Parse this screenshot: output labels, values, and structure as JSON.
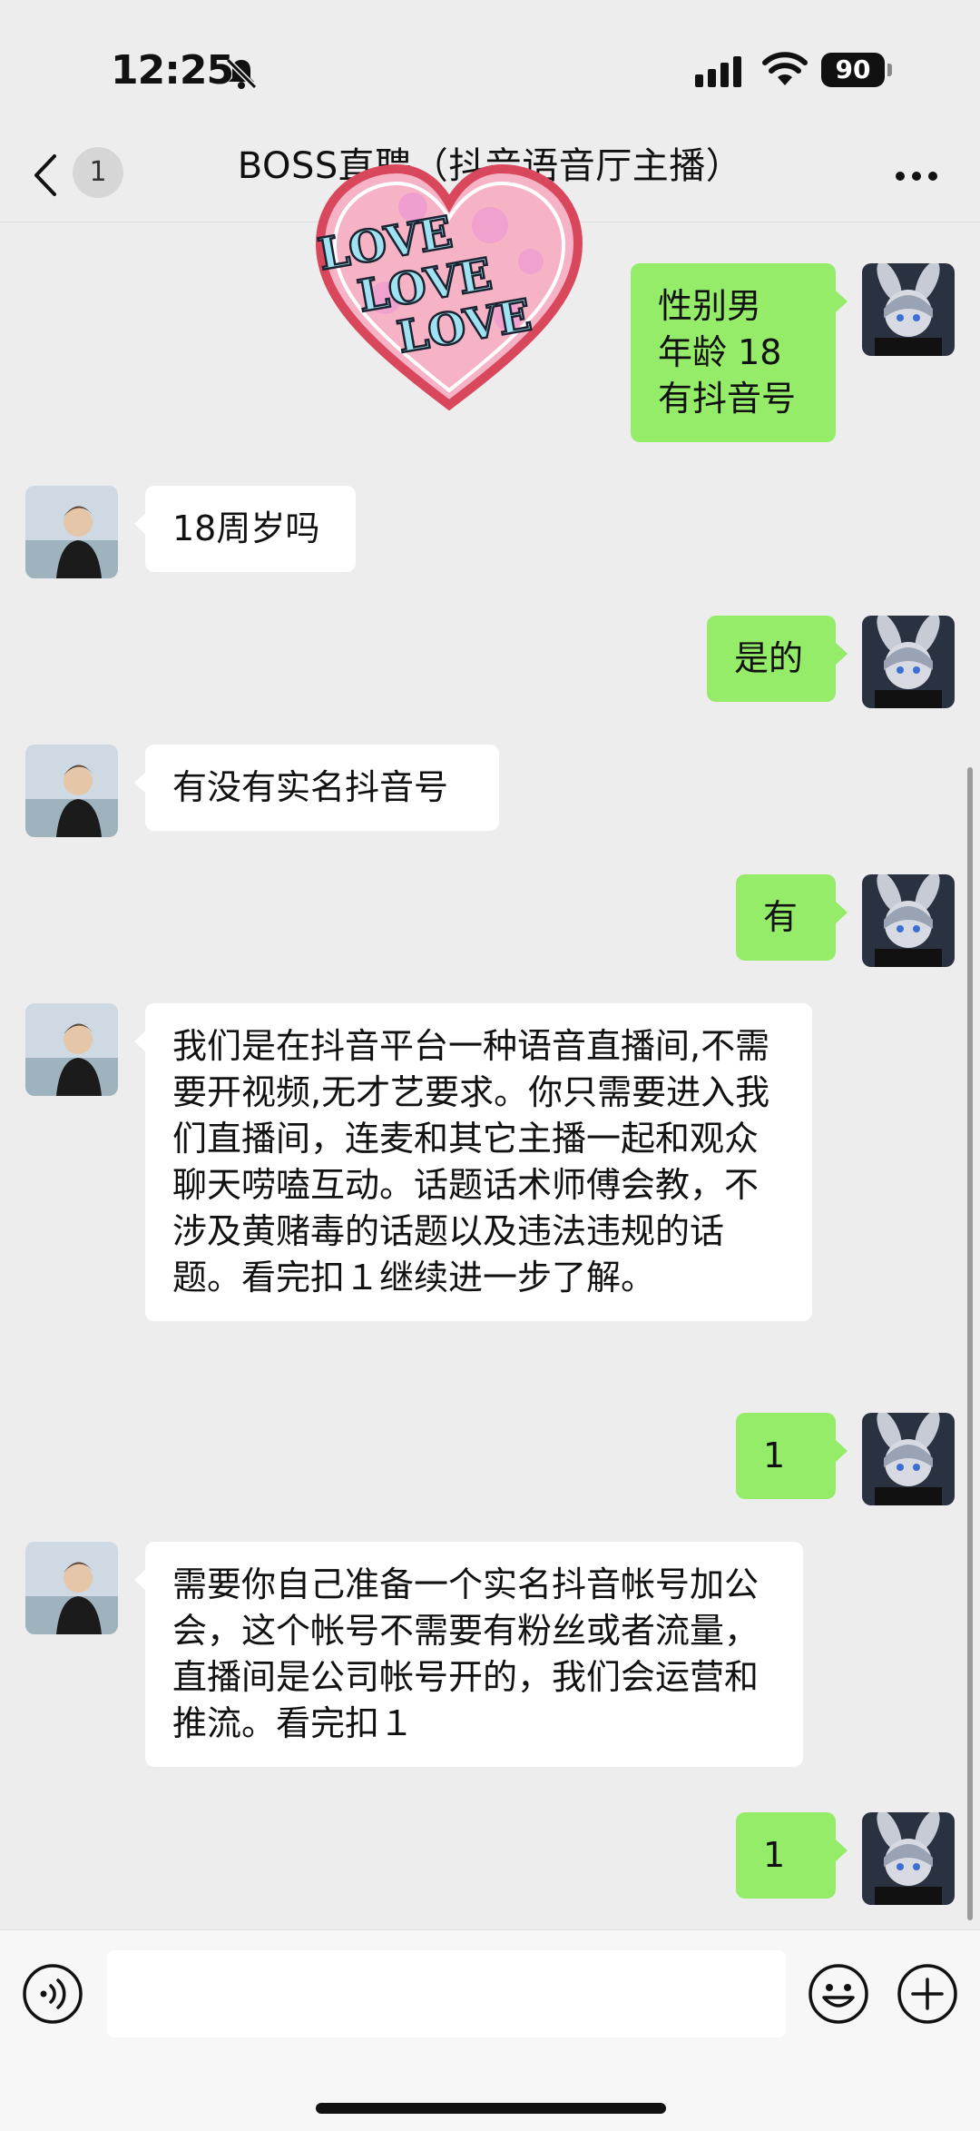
{
  "status_bar": {
    "time": "12:25",
    "battery": "90"
  },
  "nav": {
    "unread_count": "1",
    "title": "BOSS直聘（抖音语音厅主播）"
  },
  "sticker": {
    "lines": [
      "LOVE",
      "LOVE",
      "LOVE"
    ]
  },
  "messages": [
    {
      "side": "right",
      "text": "性别男\n年龄 18\n有抖音号"
    },
    {
      "side": "left",
      "text": "18周岁吗"
    },
    {
      "side": "right",
      "text": "是的"
    },
    {
      "side": "left",
      "text": "有没有实名抖音号"
    },
    {
      "side": "right",
      "text": "有"
    },
    {
      "side": "left",
      "text": "我们是在抖音平台一种语音直播间,不需要开视频,无才艺要求。你只需要进入我们直播间，连麦和其它主播一起和观众聊天唠嗑互动。话题话术师傅会教，不涉及黄赌毒的话题以及违法违规的话题。看完扣１继续进一步了解。"
    },
    {
      "side": "right",
      "text": "1"
    },
    {
      "side": "left",
      "text": "需要你自己准备一个实名抖音帐号加公会，这个帐号不需要有粉丝或者流量，直播间是公司帐号开的，我们会运营和推流。看完扣１"
    },
    {
      "side": "right",
      "text": "1"
    }
  ],
  "colors": {
    "background": "#ededed",
    "sent_bubble": "#95ec69",
    "received_bubble": "#ffffff",
    "input_bar": "#f7f7f7"
  },
  "icons": {
    "back": "chevron-left-icon",
    "more": "more-dots-icon",
    "voice": "voice-icon",
    "emoji": "emoji-icon",
    "plus": "plus-icon"
  }
}
